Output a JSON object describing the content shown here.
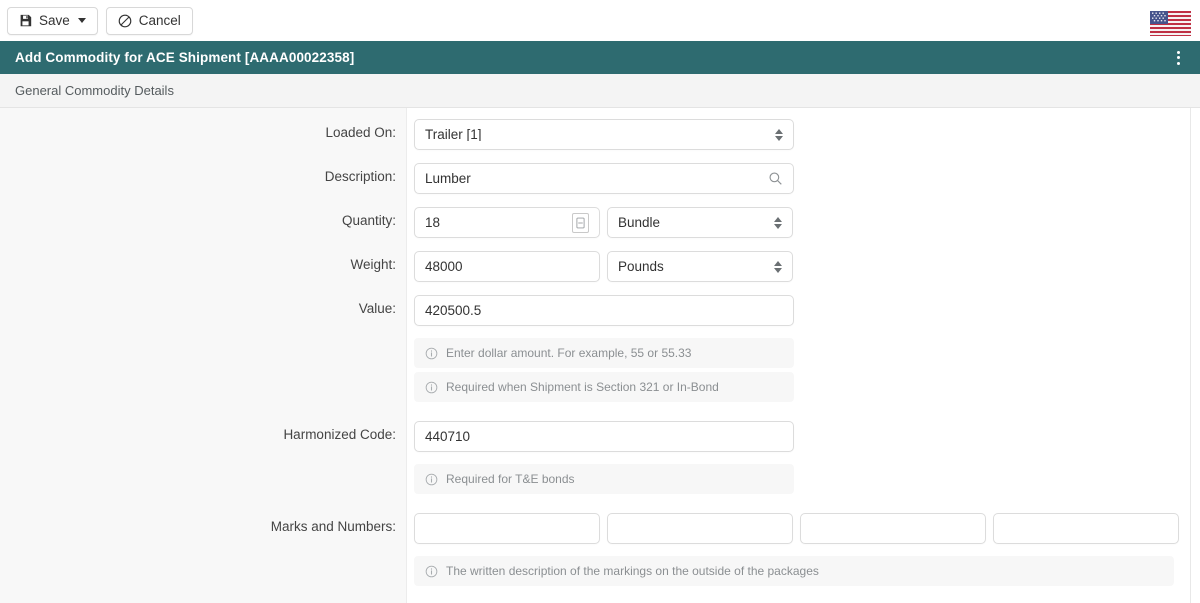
{
  "toolbar": {
    "save_label": "Save",
    "cancel_label": "Cancel",
    "save_icon": "save-floppy-icon",
    "save_caret_icon": "chevron-down-icon",
    "cancel_icon": "no-entry-circle-slash-icon",
    "locale_flag": "us-flag-icon"
  },
  "panel": {
    "title": "Add Commodity for ACE Shipment [AAAA00022358]",
    "menu_icon": "kebab-vertical-icon",
    "accent_color": "#2e6b70"
  },
  "section": {
    "title": "General Commodity Details"
  },
  "fields": {
    "loaded_on": {
      "label": "Loaded On:",
      "value": "Trailer [1]",
      "icon": "chevron-updown-icon"
    },
    "description": {
      "label": "Description:",
      "value": "Lumber",
      "icon": "search-icon"
    },
    "quantity": {
      "label": "Quantity:",
      "value": "18",
      "icon": "stepper-icon",
      "unit": "Bundle",
      "unit_icon": "chevron-updown-icon"
    },
    "weight": {
      "label": "Weight:",
      "value": "48000",
      "unit": "Pounds",
      "unit_icon": "chevron-updown-icon"
    },
    "value": {
      "label": "Value:",
      "value": "420500.5",
      "hint1": "Enter dollar amount. For example, 55 or 55.33",
      "hint2": "Required when Shipment is Section 321 or In-Bond",
      "hint_icon": "info-circle-icon"
    },
    "harmonized_code": {
      "label": "Harmonized Code:",
      "value": "440710",
      "hint": "Required for T&E bonds",
      "hint_icon": "info-circle-icon"
    },
    "marks_and_numbers": {
      "label": "Marks and Numbers:",
      "values": [
        "",
        "",
        "",
        ""
      ],
      "hint": "The written description of the markings on the outside of the packages",
      "hint_icon": "info-circle-icon"
    }
  }
}
